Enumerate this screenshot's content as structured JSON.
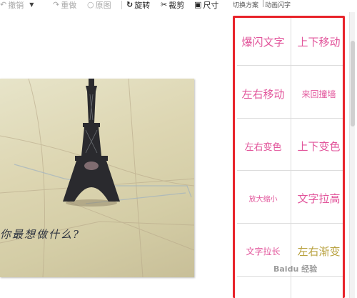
{
  "toolbar": {
    "undo": "撤销",
    "redo": "重做",
    "original": "原图",
    "rotate": "旋转",
    "crop": "裁剪",
    "resize": "尺寸"
  },
  "right_header": {
    "label": "切换方案",
    "selected": "动画闪字"
  },
  "effects": [
    {
      "label": "爆闪文字"
    },
    {
      "label": "上下移动"
    },
    {
      "label": "左右移动"
    },
    {
      "label": "来回撞墙"
    },
    {
      "label": "左右变色"
    },
    {
      "label": "上下变色"
    },
    {
      "label": "放大缩小"
    },
    {
      "label": "文字拉高"
    },
    {
      "label": "文字拉长"
    },
    {
      "label": "左右渐变"
    }
  ],
  "canvas": {
    "caption": "你最想做什么?"
  },
  "colors": {
    "highlight_border": "#e8232a",
    "effect_text": "#e2559b"
  },
  "watermark": "Baidu 经验"
}
